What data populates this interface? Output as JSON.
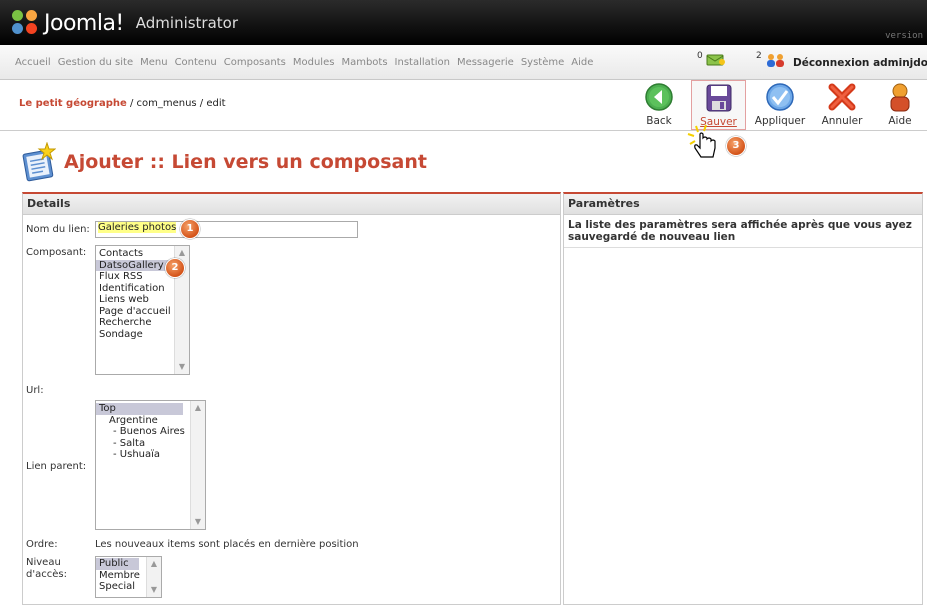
{
  "header": {
    "logo_text": "Joomla!",
    "logo_sub": "Administrator",
    "version_label": "version"
  },
  "menu": {
    "items": [
      "Accueil",
      "Gestion du site",
      "Menu",
      "Contenu",
      "Composants",
      "Modules",
      "Mambots",
      "Installation",
      "Messagerie",
      "Système",
      "Aide"
    ],
    "messages_count": "0",
    "users_count": "2",
    "logout_label": "Déconnexion adminjdo"
  },
  "toolbar": {
    "breadcrumb_site": "Le petit géographe",
    "breadcrumb_path": " / com_menus / edit",
    "back_label": "Back",
    "save_label": "Sauver",
    "apply_label": "Appliquer",
    "cancel_label": "Annuler",
    "help_label": "Aide"
  },
  "page": {
    "title": "Ajouter :: Lien vers un composant"
  },
  "details": {
    "heading": "Details",
    "name_label": "Nom du lien:",
    "name_value": "Galeries photos",
    "component_label": "Composant:",
    "components": [
      "Contacts",
      "DatsoGallery",
      "Flux RSS",
      "Identification",
      "Liens web",
      "Page d'accueil",
      "Recherche",
      "Sondage"
    ],
    "component_selected_index": 1,
    "url_label": "Url:",
    "parent_label": "Lien parent:",
    "parents": [
      "Top",
      "Argentine",
      "- Buenos Aires",
      "- Salta",
      "- Ushuaïa"
    ],
    "order_label": "Ordre:",
    "order_text": "Les nouveaux items sont placés en dernière position",
    "access_label_1": "Niveau",
    "access_label_2": "d'accès:",
    "access_levels": [
      "Public",
      "Membre",
      "Special"
    ]
  },
  "params": {
    "heading": "Paramètres",
    "text": "La liste des paramètres sera affichée après que vous ayez sauvegardé de nouveau lien"
  },
  "badges": [
    "1",
    "2",
    "3"
  ],
  "colors": {
    "accent": "#c64934",
    "badge": "#e06a2c"
  }
}
